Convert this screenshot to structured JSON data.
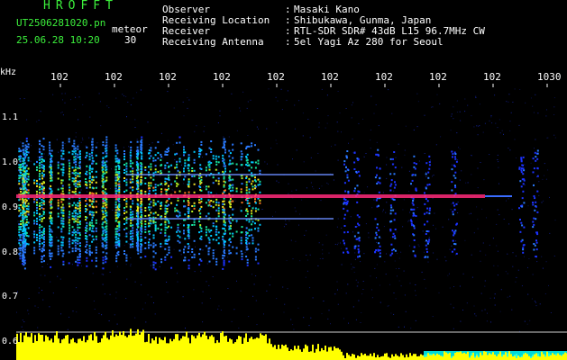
{
  "header": {
    "title": "HROFFT",
    "filename": "UT2506281020.pn",
    "meteor_label": "meteor",
    "datetime": "25.06.28 10:20",
    "meteor_count": "30"
  },
  "info": [
    {
      "label": "Observer",
      "value": "Masaki Kano"
    },
    {
      "label": "Receiving Location",
      "value": "Shibukawa, Gunma, Japan"
    },
    {
      "label": "Receiver",
      "value": "RTL-SDR SDR# 43dB L15 96.7MHz CW"
    },
    {
      "label": "Receiving Antenna",
      "value": "5el Yagi Az 280 for Seoul"
    }
  ],
  "axis": {
    "y_unit": "kHz",
    "y_ticks": [
      "1.1",
      "1.0",
      "0.9",
      "0.8",
      "0.7",
      "0.6"
    ],
    "x_ticks": [
      "102",
      "102",
      "102",
      "102",
      "102",
      "102",
      "102",
      "102",
      "102",
      "1030"
    ]
  },
  "colors": {
    "label_green": "#3cf03c",
    "text_white": "#ffffff",
    "carrier_pink": "#ff2a7a",
    "level_yellow": "#ffff00",
    "level_cyan": "#00ffff"
  }
}
